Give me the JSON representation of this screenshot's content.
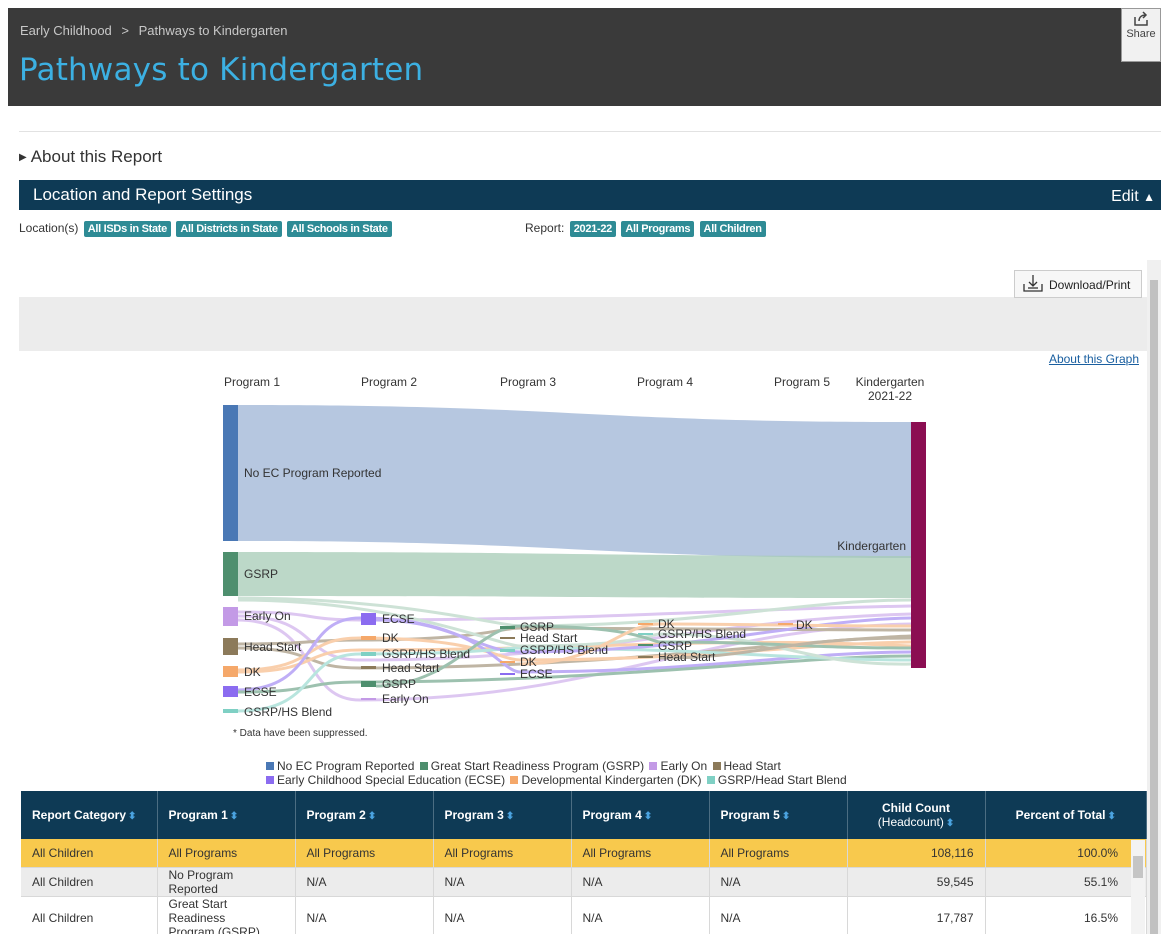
{
  "breadcrumb": {
    "parent": "Early Childhood",
    "separator": ">",
    "current": "Pathways to Kindergarten"
  },
  "page_title": "Pathways to Kindergarten",
  "share_label": "Share",
  "about_report": "About this Report",
  "settings": {
    "title": "Location and Report Settings",
    "edit_label": "Edit",
    "location_label": "Location(s)",
    "locations": [
      "All ISDs in State",
      "All Districts in State",
      "All Schools in State"
    ],
    "report_label": "Report:",
    "report_filters": [
      "2021-22",
      "All Programs",
      "All Children"
    ]
  },
  "download_label": "Download/Print",
  "about_graph": "About this Graph",
  "sankey": {
    "columns": [
      "Program 1",
      "Program 2",
      "Program 3",
      "Program 4",
      "Program 5",
      "Kindergarten",
      "2021-22"
    ],
    "program1_nodes": [
      "No EC Program Reported",
      "GSRP",
      "Early On",
      "Head Start",
      "DK",
      "ECSE",
      "GSRP/HS Blend"
    ],
    "program2_nodes": [
      "ECSE",
      "DK",
      "GSRP/HS Blend",
      "Head Start",
      "GSRP",
      "Early On"
    ],
    "program3_nodes": [
      "GSRP",
      "Head Start",
      "GSRP/HS Blend",
      "DK",
      "ECSE"
    ],
    "program4_nodes": [
      "DK",
      "GSRP/HS Blend",
      "GSRP",
      "Head Start"
    ],
    "program5_nodes": [
      "DK"
    ],
    "kindergarten_node": "Kindergarten",
    "note": "* Data have been suppressed."
  },
  "legend": [
    {
      "label": "No EC Program Reported",
      "color": "#4a78b5"
    },
    {
      "label": "Great Start Readiness Program (GSRP)",
      "color": "#4e8f6e"
    },
    {
      "label": "Early On",
      "color": "#c39ae6"
    },
    {
      "label": "Head Start",
      "color": "#8c7a5a"
    },
    {
      "label": "Early Childhood Special Education (ECSE)",
      "color": "#8b6cf0"
    },
    {
      "label": "Developmental Kindergarten (DK)",
      "color": "#f5a86a"
    },
    {
      "label": "GSRP/Head Start Blend",
      "color": "#7fd0c4"
    }
  ],
  "table": {
    "headers": [
      "Report Category",
      "Program 1",
      "Program 2",
      "Program 3",
      "Program 4",
      "Program 5",
      "Child Count",
      "(Headcount)",
      "Percent of Total"
    ],
    "rows": [
      [
        "All Children",
        "All Programs",
        "All Programs",
        "All Programs",
        "All Programs",
        "All Programs",
        "108,116",
        "100.0%"
      ],
      [
        "All Children",
        "No Program Reported",
        "N/A",
        "N/A",
        "N/A",
        "N/A",
        "59,545",
        "55.1%"
      ],
      [
        "All Children",
        "Great Start Readiness",
        "Program (GSRP)",
        "N/A",
        "N/A",
        "N/A",
        "N/A",
        "17,787",
        "16.5%"
      ]
    ]
  }
}
